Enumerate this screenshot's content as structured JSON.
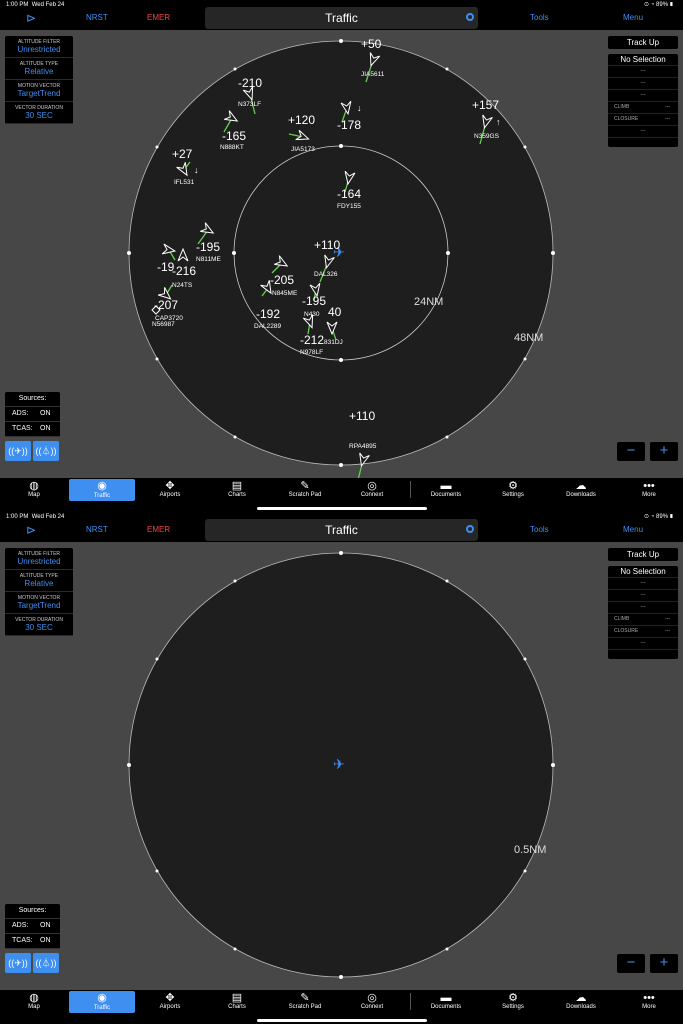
{
  "status": {
    "time": "1:00 PM",
    "date": "Wed Feb 24",
    "battery": "89%"
  },
  "nav": {
    "nrst": "NRST",
    "emer": "EMER",
    "title": "Traffic",
    "tools": "Tools",
    "menu": "Menu"
  },
  "filters": [
    {
      "label": "ALTITUDE FILTER",
      "value": "Unrestricted"
    },
    {
      "label": "ALTITUDE TYPE",
      "value": "Relative"
    },
    {
      "label": "MOTION VECTOR",
      "value": "TargetTrend"
    },
    {
      "label": "VECTOR DURATION",
      "value": "30 SEC"
    }
  ],
  "track_up": "Track Up",
  "selection": {
    "title": "No Selection",
    "dash": "---",
    "climb_label": "CLIMB",
    "closure_label": "CLOSURE"
  },
  "sources": {
    "title": "Sources:",
    "ads_label": "ADS:",
    "ads_value": "ON",
    "tcas_label": "TCAS:",
    "tcas_value": "ON"
  },
  "zoom": {
    "minus": "−",
    "plus": "+"
  },
  "tabs": [
    "Map",
    "Traffic",
    "Airports",
    "Charts",
    "Scratch Pad",
    "Connext",
    "Documents",
    "Settings",
    "Downloads",
    "More"
  ],
  "screen1": {
    "ranges": [
      {
        "label": "24NM"
      },
      {
        "label": "48NM"
      }
    ],
    "traffic": [
      {
        "alt": "+50",
        "call": "JIA5611"
      },
      {
        "alt": "-210",
        "call": "N373LF"
      },
      {
        "alt": "-165",
        "call": "N888KT"
      },
      {
        "alt": "+120",
        "call": "JIA5173"
      },
      {
        "alt": "-178",
        "call": ""
      },
      {
        "alt": "+157",
        "call": "N359GS"
      },
      {
        "alt": "+27",
        "call": "IFL531"
      },
      {
        "alt": "-164",
        "call": "FDY155"
      },
      {
        "alt": "-195",
        "call": "N811ME"
      },
      {
        "alt": "+110",
        "call": "DAL326"
      },
      {
        "alt": "-19",
        "call": ""
      },
      {
        "alt": "-216",
        "call": "N24TS"
      },
      {
        "alt": "-207",
        "call": "CAP3720"
      },
      {
        "alt": "",
        "call": "N56987"
      },
      {
        "alt": "-205",
        "call": "N845ME"
      },
      {
        "alt": "-192",
        "call": "DAL2289"
      },
      {
        "alt": "-195",
        "call": "N430"
      },
      {
        "alt": "40",
        "call": "831DJ"
      },
      {
        "alt": "-212",
        "call": "N978LF"
      },
      {
        "alt": "+110",
        "call": "RPA4895"
      }
    ]
  },
  "screen2": {
    "ranges": [
      {
        "label": "0.5NM"
      }
    ]
  }
}
